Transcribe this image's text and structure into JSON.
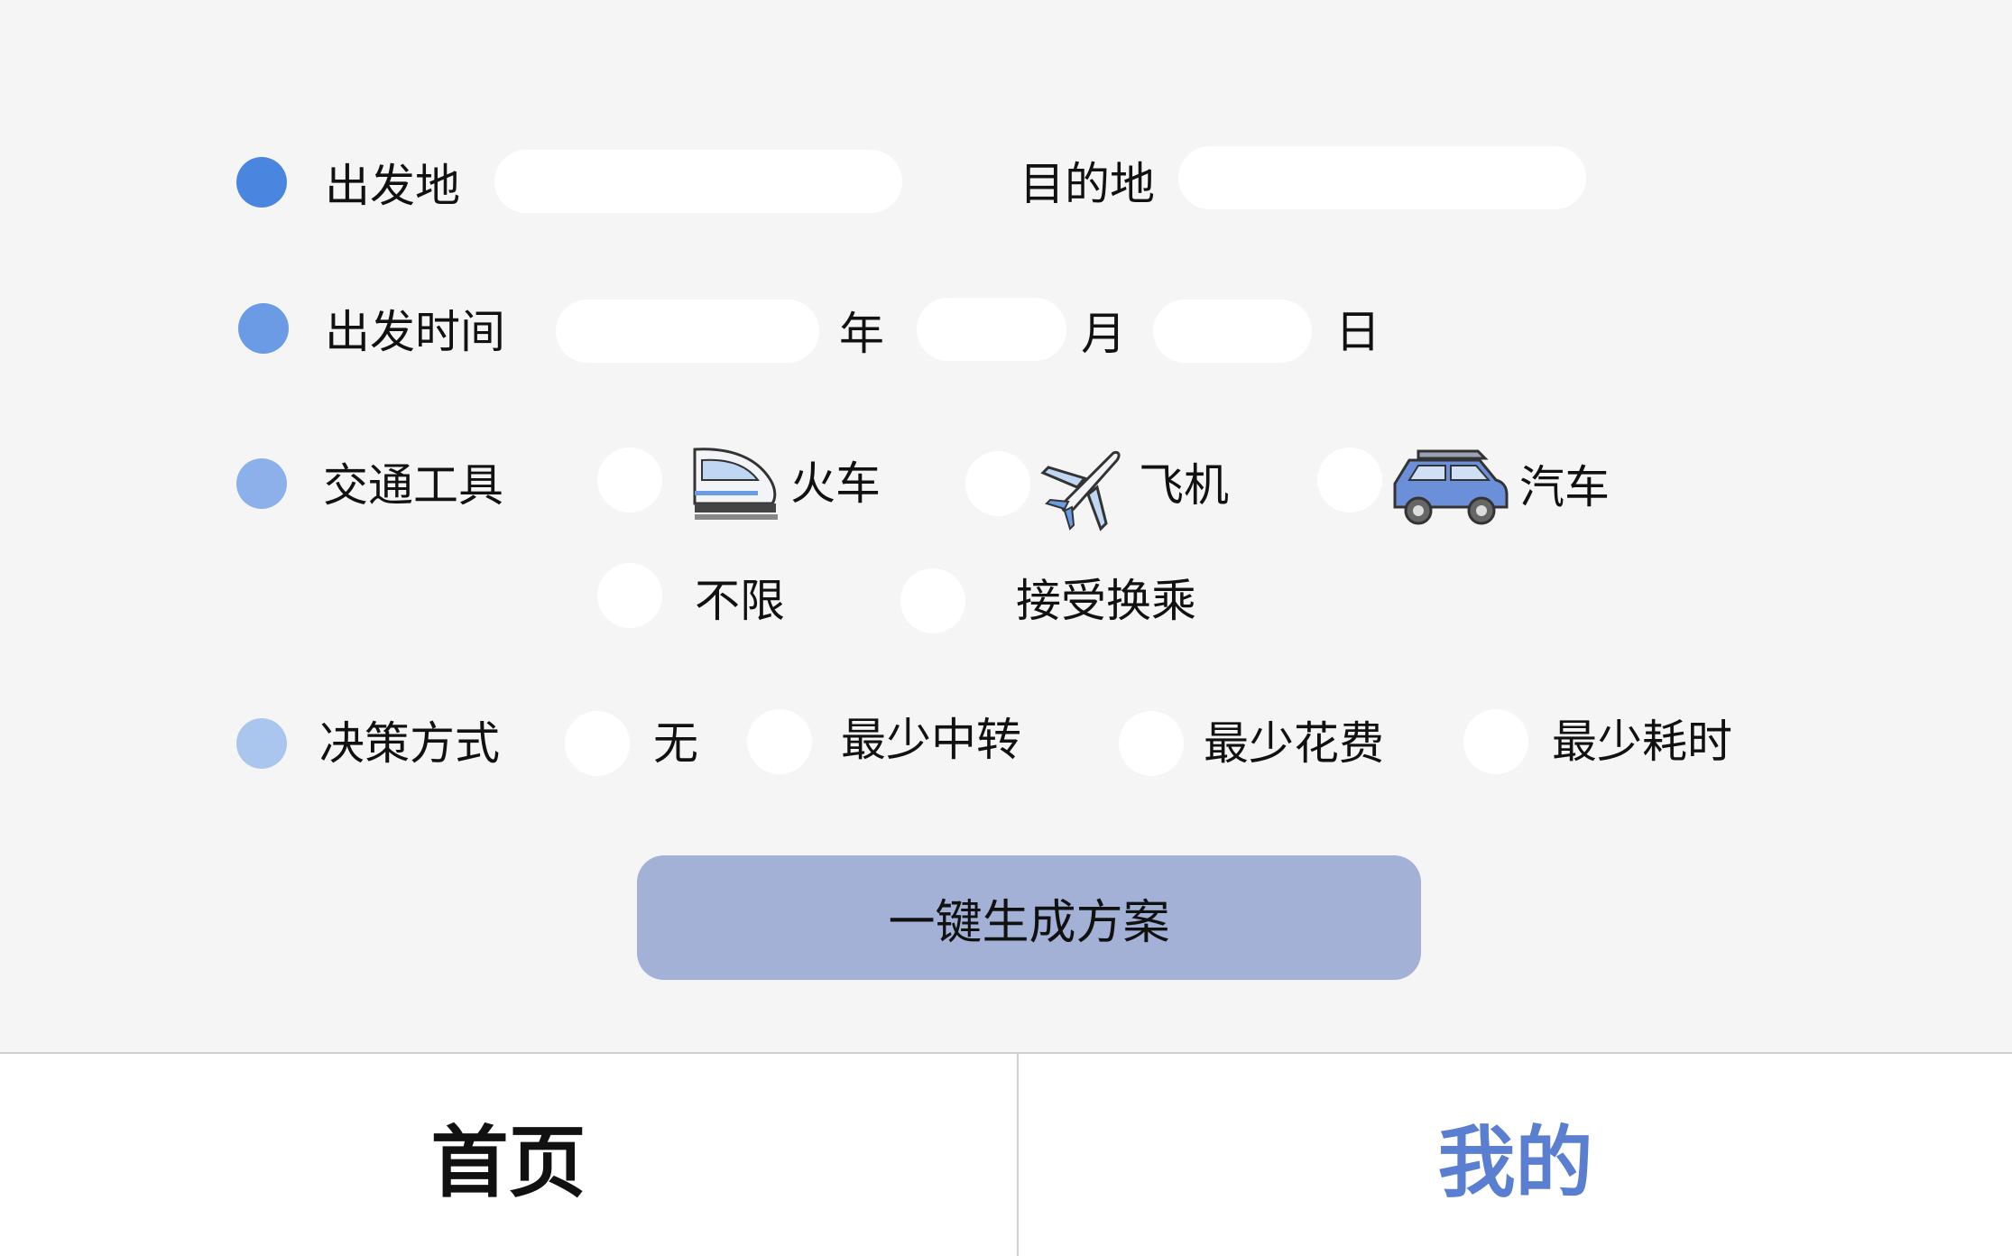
{
  "form": {
    "origin": {
      "label": "出发地",
      "value": "",
      "placeholder": ""
    },
    "destination": {
      "label": "目的地",
      "value": "",
      "placeholder": ""
    },
    "departure_time": {
      "label": "出发时间",
      "year_unit": "年",
      "month_unit": "月",
      "day_unit": "日"
    },
    "transport": {
      "label": "交通工具",
      "options": [
        "火车",
        "飞机",
        "汽车",
        "不限",
        "接受换乘"
      ]
    },
    "decision": {
      "label": "决策方式",
      "options": [
        "无",
        "最少中转",
        "最少花费",
        "最少耗时"
      ]
    },
    "generate_label": "一键生成方案"
  },
  "tabs": {
    "home": "首页",
    "mine": "我的"
  },
  "colors": {
    "dot1": "#4a86e0",
    "dot2": "#6b9be5",
    "dot3": "#8cb0e9",
    "dot4": "#aac6ee",
    "button": "#a3b1d6",
    "tab_active": "#5b7fd0"
  }
}
